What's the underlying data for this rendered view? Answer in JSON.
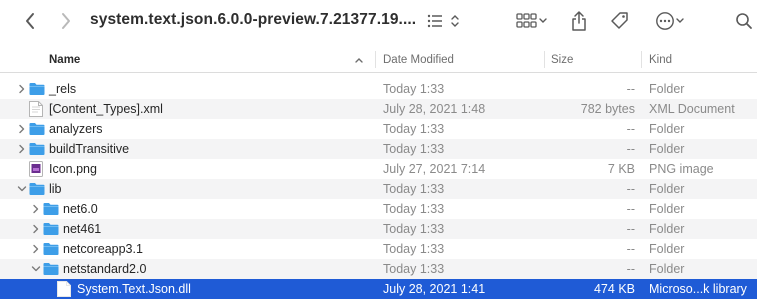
{
  "window": {
    "title": "system.text.json.6.0.0-preview.7.21377.19...."
  },
  "toolbar": {
    "back_icon": "chevron-left-icon",
    "forward_icon": "chevron-right-icon",
    "list_view_icon": "list-icon",
    "group_icon": "grid-icon",
    "share_icon": "share-icon",
    "tag_icon": "tag-icon",
    "more_icon": "ellipsis-circle-icon",
    "search_icon": "search-icon"
  },
  "columns": {
    "name": "Name",
    "date": "Date Modified",
    "size": "Size",
    "kind": "Kind"
  },
  "colors": {
    "folder": "#3d9ee8",
    "selection": "#1f5bd6"
  },
  "files": [
    {
      "name": "_rels",
      "date": "Today 1:33",
      "size": "--",
      "kind": "Folder",
      "type": "folder",
      "level": 0,
      "chevron": "right"
    },
    {
      "name": "[Content_Types].xml",
      "date": "July 28, 2021 1:48",
      "size": "782 bytes",
      "kind": "XML Document",
      "type": "doc",
      "level": 0,
      "chevron": ""
    },
    {
      "name": "analyzers",
      "date": "Today 1:33",
      "size": "--",
      "kind": "Folder",
      "type": "folder",
      "level": 0,
      "chevron": "right"
    },
    {
      "name": "buildTransitive",
      "date": "Today 1:33",
      "size": "--",
      "kind": "Folder",
      "type": "folder",
      "level": 0,
      "chevron": "right"
    },
    {
      "name": "Icon.png",
      "date": "July 27, 2021 7:14",
      "size": "7 KB",
      "kind": "PNG image",
      "type": "image",
      "level": 0,
      "chevron": ""
    },
    {
      "name": "lib",
      "date": "Today 1:33",
      "size": "--",
      "kind": "Folder",
      "type": "folder",
      "level": 0,
      "chevron": "down"
    },
    {
      "name": "net6.0",
      "date": "Today 1:33",
      "size": "--",
      "kind": "Folder",
      "type": "folder",
      "level": 1,
      "chevron": "right"
    },
    {
      "name": "net461",
      "date": "Today 1:33",
      "size": "--",
      "kind": "Folder",
      "type": "folder",
      "level": 1,
      "chevron": "right"
    },
    {
      "name": "netcoreapp3.1",
      "date": "Today 1:33",
      "size": "--",
      "kind": "Folder",
      "type": "folder",
      "level": 1,
      "chevron": "right"
    },
    {
      "name": "netstandard2.0",
      "date": "Today 1:33",
      "size": "--",
      "kind": "Folder",
      "type": "folder",
      "level": 1,
      "chevron": "down"
    },
    {
      "name": "System.Text.Json.dll",
      "date": "July 28, 2021 1:41",
      "size": "474 KB",
      "kind": "Microso...k library",
      "type": "doc",
      "level": 2,
      "chevron": "",
      "selected": true
    }
  ]
}
